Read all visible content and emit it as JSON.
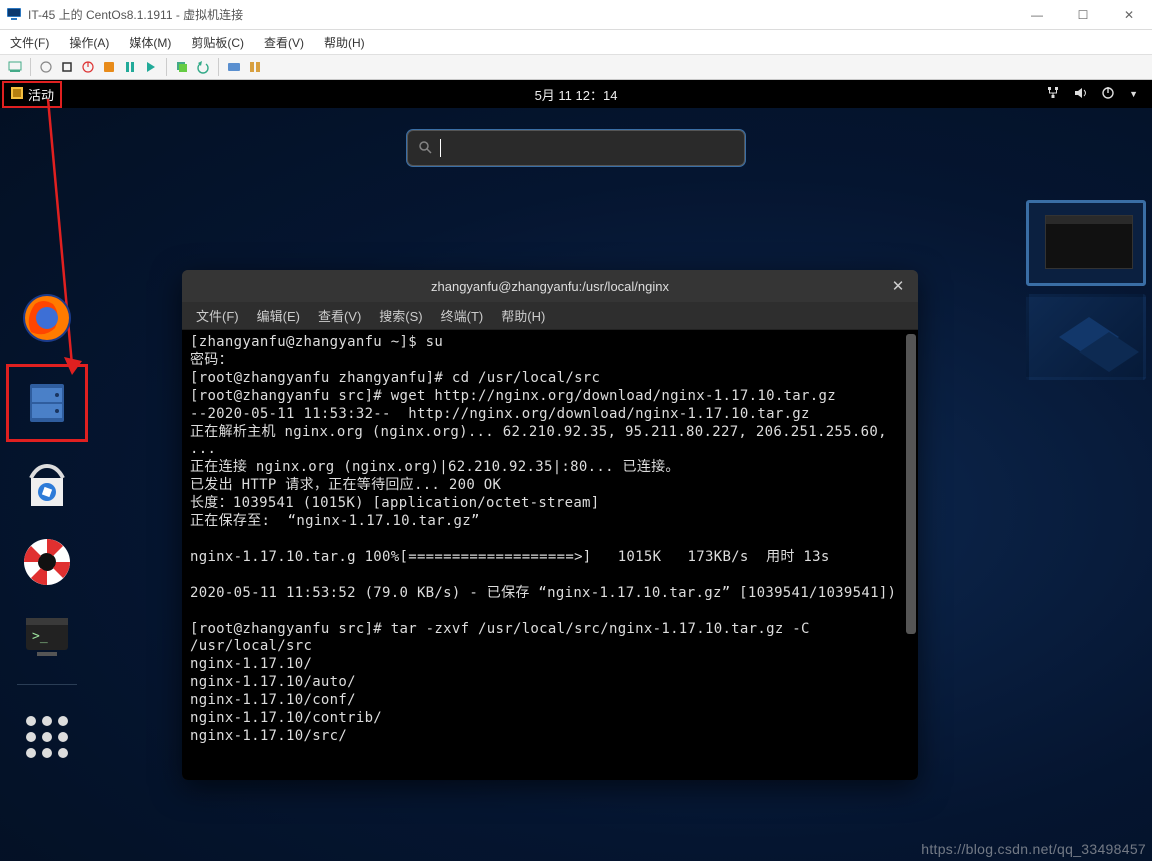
{
  "host": {
    "title": "IT-45 上的 CentOs8.1.1911 - 虚拟机连接",
    "menu": {
      "file": "文件(F)",
      "action": "操作(A)",
      "media": "媒体(M)",
      "clipboard": "剪贴板(C)",
      "view": "查看(V)",
      "help": "帮助(H)"
    },
    "winbtn": {
      "min": "—",
      "max": "☐",
      "close": "✕"
    }
  },
  "gnome": {
    "activities": "活动",
    "clock": "5月 11 12：14",
    "search_placeholder": ""
  },
  "terminal": {
    "title": "zhangyanfu@zhangyanfu:/usr/local/nginx",
    "menu": {
      "file": "文件(F)",
      "edit": "编辑(E)",
      "view": "查看(V)",
      "search": "搜索(S)",
      "term": "终端(T)",
      "help": "帮助(H)"
    },
    "output": "[zhangyanfu@zhangyanfu ~]$ su\n密码：\n[root@zhangyanfu zhangyanfu]# cd /usr/local/src\n[root@zhangyanfu src]# wget http://nginx.org/download/nginx-1.17.10.tar.gz\n--2020-05-11 11:53:32--  http://nginx.org/download/nginx-1.17.10.tar.gz\n正在解析主机 nginx.org (nginx.org)... 62.210.92.35, 95.211.80.227, 206.251.255.60, ...\n正在连接 nginx.org (nginx.org)|62.210.92.35|:80... 已连接。\n已发出 HTTP 请求，正在等待回应... 200 OK\n长度：1039541 (1015K) [application/octet-stream]\n正在保存至:  “nginx-1.17.10.tar.gz”\n\nnginx-1.17.10.tar.g 100%[===================>]   1015K   173KB/s  用时 13s\n\n2020-05-11 11:53:52 (79.0 KB/s) - 已保存 “nginx-1.17.10.tar.gz” [1039541/1039541])\n\n[root@zhangyanfu src]# tar -zxvf /usr/local/src/nginx-1.17.10.tar.gz -C /usr/local/src\nnginx-1.17.10/\nnginx-1.17.10/auto/\nnginx-1.17.10/conf/\nnginx-1.17.10/contrib/\nnginx-1.17.10/src/"
  },
  "watermark": "https://blog.csdn.net/qq_33498457"
}
